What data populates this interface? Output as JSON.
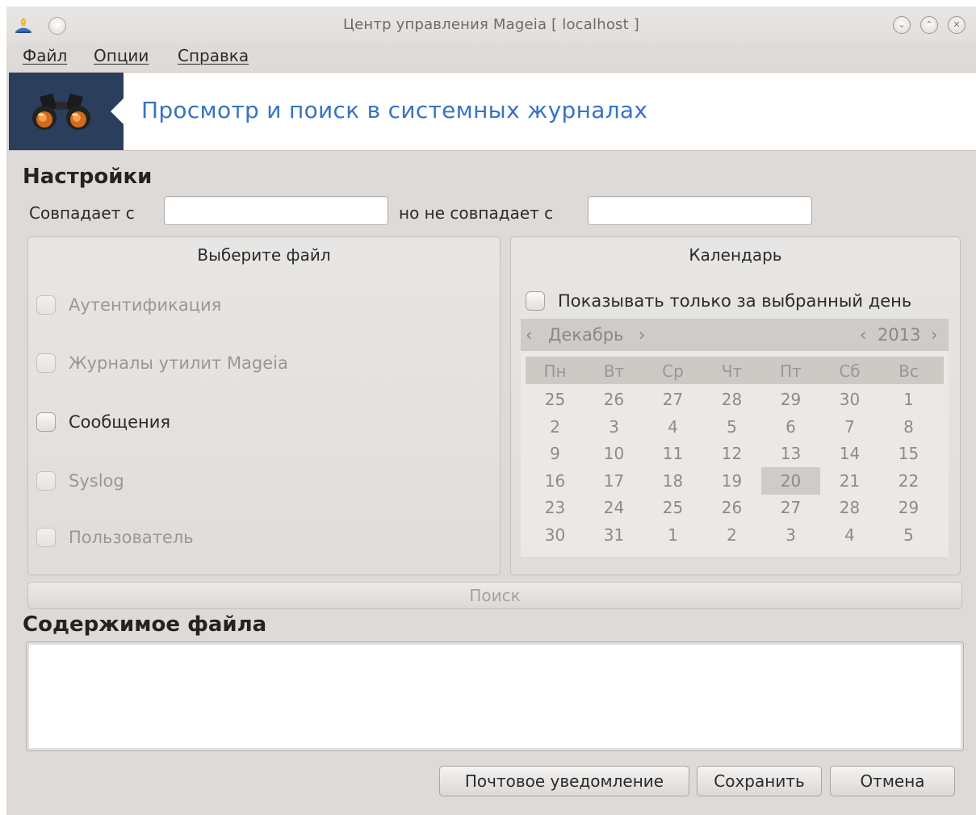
{
  "window": {
    "title": "Центр управления Mageia  [ localhost ]"
  },
  "menu": [
    "Файл",
    "Опции",
    "Справка"
  ],
  "banner": {
    "title": "Просмотр и поиск в системных журналах"
  },
  "settings": {
    "heading": "Настройки",
    "match_label": "Совпадает с",
    "match_value": "",
    "nomatch_label": "но не совпадает с",
    "nomatch_value": ""
  },
  "file_group": {
    "title": "Выберите файл",
    "items": [
      {
        "label": "Аутентификация",
        "checked": false,
        "enabled": false
      },
      {
        "label": "Журналы утилит Mageia",
        "checked": false,
        "enabled": false
      },
      {
        "label": "Сообщения",
        "checked": false,
        "enabled": true
      },
      {
        "label": "Syslog",
        "checked": false,
        "enabled": false
      },
      {
        "label": "Пользователь",
        "checked": false,
        "enabled": false
      }
    ]
  },
  "calendar": {
    "title": "Календарь",
    "only_day_label": "Показывать только за выбранный день",
    "month": "Декабрь",
    "year": "2013",
    "weekdays": [
      "Пн",
      "Вт",
      "Ср",
      "Чт",
      "Пт",
      "Сб",
      "Вс"
    ],
    "weeks": [
      [
        "25",
        "26",
        "27",
        "28",
        "29",
        "30",
        "1"
      ],
      [
        "2",
        "3",
        "4",
        "5",
        "6",
        "7",
        "8"
      ],
      [
        "9",
        "10",
        "11",
        "12",
        "13",
        "14",
        "15"
      ],
      [
        "16",
        "17",
        "18",
        "19",
        "20",
        "21",
        "22"
      ],
      [
        "23",
        "24",
        "25",
        "26",
        "27",
        "28",
        "29"
      ],
      [
        "30",
        "31",
        "1",
        "2",
        "3",
        "4",
        "5"
      ]
    ],
    "selected_day": "20"
  },
  "search_button": "Поиск",
  "content": {
    "heading": "Содержимое файла"
  },
  "buttons": {
    "mail": "Почтовое уведомление",
    "save": "Сохранить",
    "cancel": "Отмена"
  },
  "colors": {
    "banner_bg": "#2b3e5c",
    "banner_title": "#3873c6",
    "window_bg": "#dedad7"
  }
}
